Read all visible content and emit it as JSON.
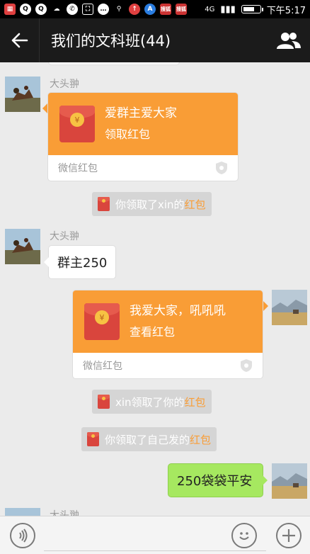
{
  "status_bar": {
    "time": "下午5:17",
    "network": "4G",
    "icons": [
      "game-icon",
      "chat-bubble-icon",
      "chat-bubble-icon",
      "weather-icon",
      "whatsapp-icon",
      "scan-icon",
      "message-icon",
      "location-icon",
      "upload-icon",
      "app-icon",
      "news-icon",
      "news-icon"
    ],
    "news_label": "搜狐新闻"
  },
  "header": {
    "title": "我们的文科班(44)",
    "back_icon": "arrow-left-icon",
    "group_icon": "group-members-icon"
  },
  "messages": {
    "m1_sender": "大头翀",
    "m1_greeting": "爱群主爱大家",
    "m1_action": "领取红包",
    "m1_footer": "微信红包",
    "n1_prefix": "你领取了xin的",
    "n1_link": "红包",
    "m2_sender": "大头翀",
    "m2_text": "群主250",
    "m3_greeting": "我爱大家，吼吼吼",
    "m3_action": "查看红包",
    "m3_footer": "微信红包",
    "n2_prefix": "xin领取了你的",
    "n2_link": "红包",
    "n3_prefix": "你领取了自己发的",
    "n3_link": "红包",
    "m4_text": "250袋袋平安",
    "m5_sender": "大头翀"
  },
  "colors": {
    "redpacket": "#f99d36",
    "sent_bubble": "#a6e860",
    "header_bg": "#1b1b1b",
    "chat_bg": "#ebebeb"
  }
}
